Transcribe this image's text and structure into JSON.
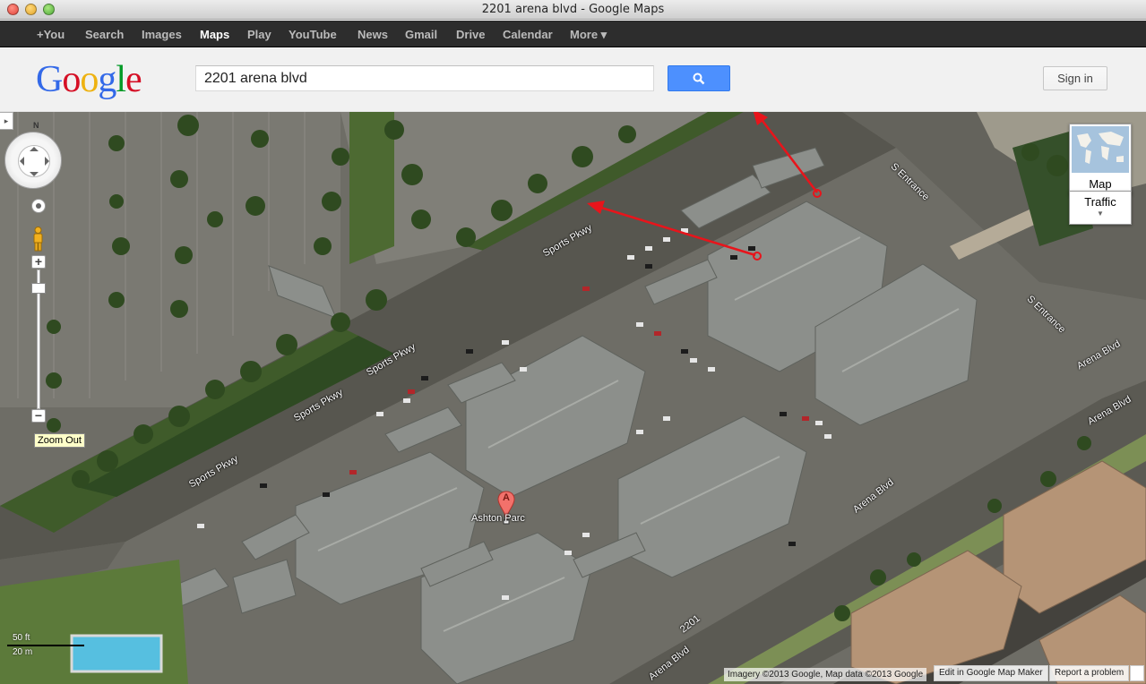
{
  "window": {
    "title": "2201 arena blvd - Google Maps"
  },
  "gbar": {
    "items": [
      {
        "label": "+You",
        "active": false
      },
      {
        "label": "Search",
        "active": false
      },
      {
        "label": "Images",
        "active": false
      },
      {
        "label": "Maps",
        "active": true
      },
      {
        "label": "Play",
        "active": false
      },
      {
        "label": "YouTube",
        "active": false
      },
      {
        "label": "News",
        "active": false
      },
      {
        "label": "Gmail",
        "active": false
      },
      {
        "label": "Drive",
        "active": false
      },
      {
        "label": "Calendar",
        "active": false
      },
      {
        "label": "More ▾",
        "active": false
      }
    ]
  },
  "header": {
    "logo_letters": [
      "G",
      "o",
      "o",
      "g",
      "l",
      "e"
    ],
    "search_value": "2201 arena blvd",
    "signin_label": "Sign in"
  },
  "map": {
    "compass": "N",
    "zoom_in": "+",
    "zoom_out": "−",
    "zoom_tooltip": "Zoom Out",
    "collapse": "▸",
    "map_type_label": "Map",
    "traffic_label": "Traffic",
    "scale_ft": "50 ft",
    "scale_m": "20 m",
    "marker_letter": "A",
    "marker_label": "Ashton Parc",
    "road_labels": [
      "Sports Pkwy",
      "Sports Pkwy",
      "Sports Pkwy",
      "Sports Pkwy",
      "S Entrance",
      "S Entrance",
      "Arena Blvd",
      "Arena Blvd",
      "Arena Blvd",
      "Arena Blvd",
      "2201"
    ],
    "attribution": "Imagery ©2013 Google, Map data ©2013 Google",
    "edit_link": "Edit in Google Map Maker",
    "report_link": "Report a problem",
    "annotation_color": "#e8141b"
  }
}
